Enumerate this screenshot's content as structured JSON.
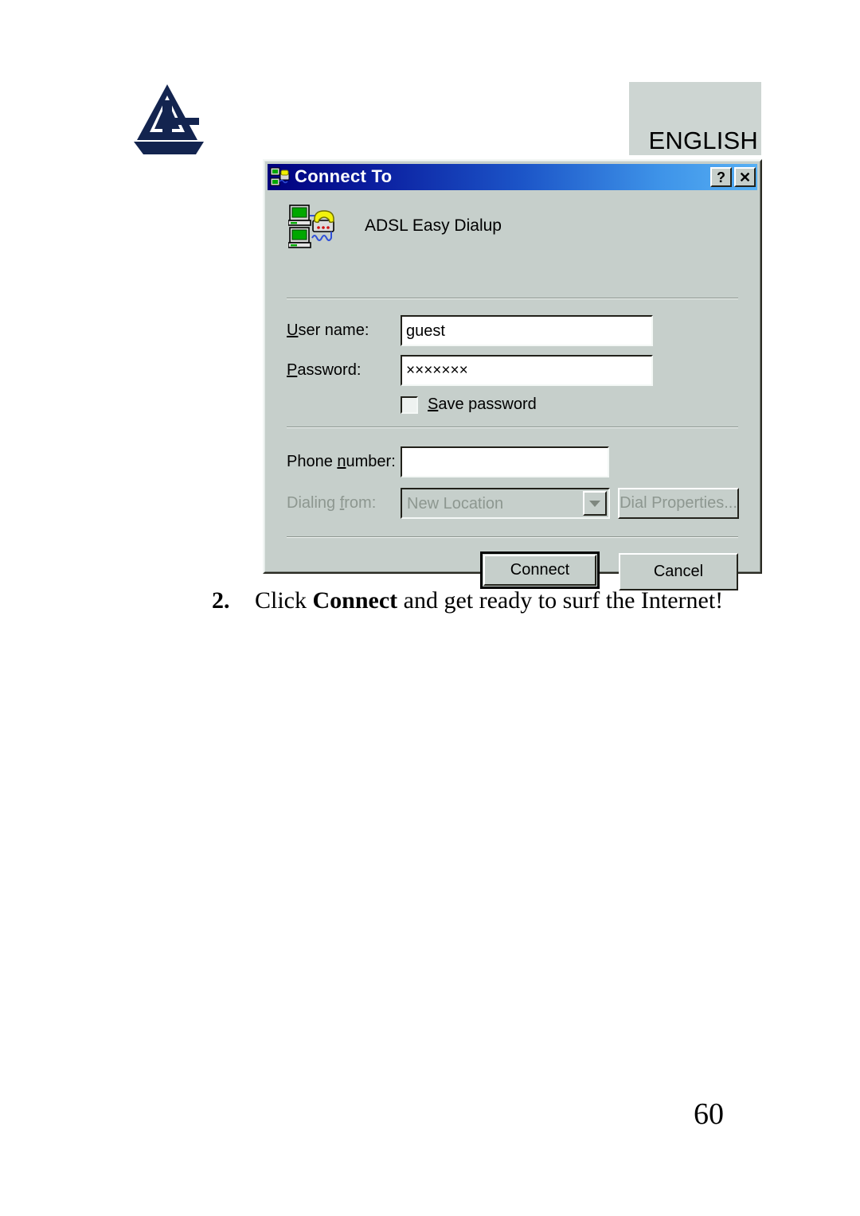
{
  "page": {
    "language_banner": "ENGLISH",
    "page_number": "60",
    "logo_name": "atlantis-land-logo"
  },
  "dialog": {
    "title": "Connect To",
    "title_icon": "dialup-connection-icon",
    "help_button": "?",
    "close_button": "✕",
    "connection_name": "ADSL Easy Dialup",
    "connection_icon": "dialup-connection-icon",
    "fields": {
      "user_name": {
        "label_prefix": "",
        "label_accesskey": "U",
        "label": "User name:",
        "value": "guest"
      },
      "password": {
        "label": "Password:",
        "label_accesskey": "P",
        "value": "×××××××"
      },
      "save_password": {
        "label": "Save password",
        "label_accesskey": "S",
        "checked": false
      },
      "phone_number": {
        "label": "Phone number:",
        "label_accesskey": "n",
        "value": ""
      },
      "dialing_from": {
        "label": "Dialing from:",
        "label_accesskey": "f",
        "value": "New Location",
        "disabled": true
      }
    },
    "buttons": {
      "dial_properties": {
        "label": "Dial Properties...",
        "disabled": true
      },
      "connect": {
        "label": "Connect",
        "default": true
      },
      "cancel": {
        "label": "Cancel",
        "default": false
      }
    },
    "colors": {
      "face": "#c6cfcb",
      "title_left": "#00007d",
      "title_right": "#57b0f4",
      "disabled_text": "#8d9790"
    }
  },
  "instruction": {
    "number": "2.",
    "text_before": "Click ",
    "bold_text": "Connect",
    "text_after": " and get ready to surf the Internet!"
  }
}
